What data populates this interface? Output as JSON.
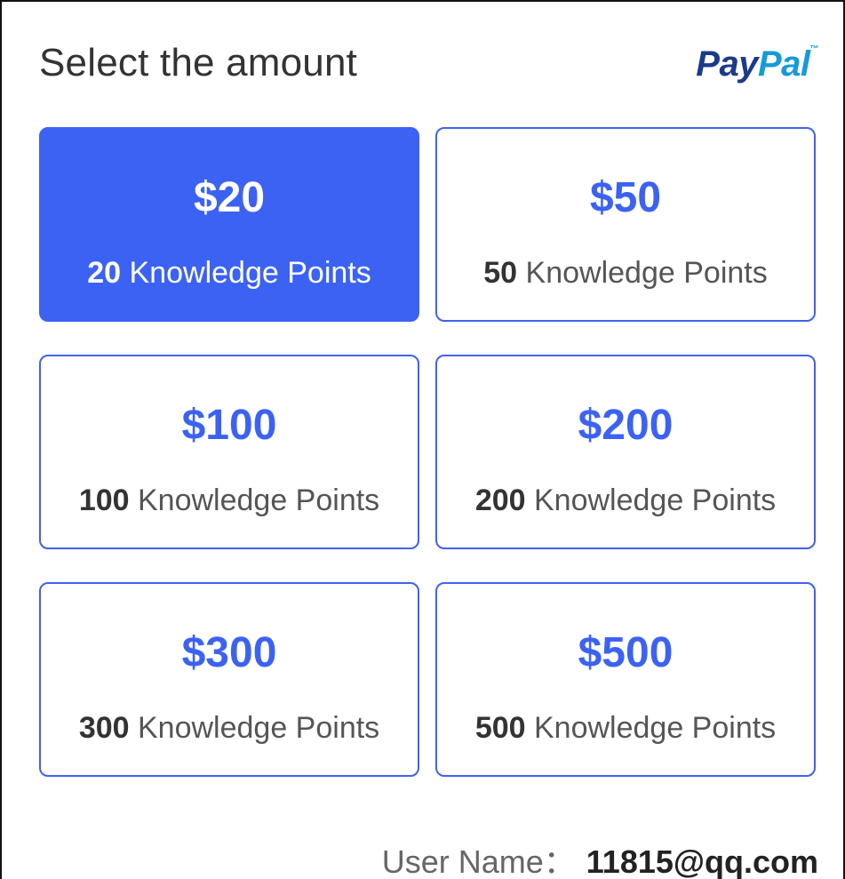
{
  "header": {
    "title": "Select the amount",
    "logo": {
      "pay": "Pay",
      "pal": "Pal",
      "tm": "™"
    }
  },
  "options": [
    {
      "price": "$20",
      "points_num": "20",
      "points_label": " Knowledge Points",
      "selected": true
    },
    {
      "price": "$50",
      "points_num": "50",
      "points_label": " Knowledge Points",
      "selected": false
    },
    {
      "price": "$100",
      "points_num": "100",
      "points_label": " Knowledge Points",
      "selected": false
    },
    {
      "price": "$200",
      "points_num": "200",
      "points_label": " Knowledge Points",
      "selected": false
    },
    {
      "price": "$300",
      "points_num": "300",
      "points_label": " Knowledge Points",
      "selected": false
    },
    {
      "price": "$500",
      "points_num": "500",
      "points_label": " Knowledge Points",
      "selected": false
    }
  ],
  "user": {
    "label": "User Name：",
    "value": "11815@qq.com"
  },
  "colors": {
    "accent": "#3c62f4",
    "paypal_dark": "#1b3b8a",
    "paypal_light": "#169bd7"
  }
}
